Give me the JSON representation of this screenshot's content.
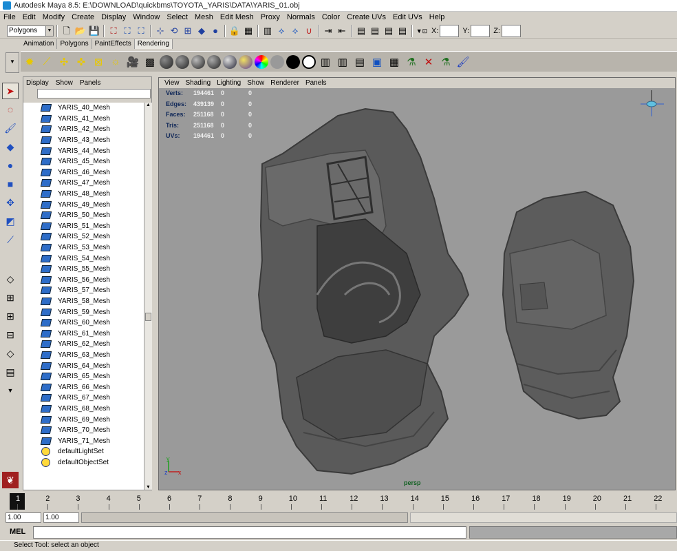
{
  "window": {
    "title": "Autodesk Maya 8.5: E:\\DOWNLOAD\\quickbms\\TOYOTA_YARIS\\DATA\\YARIS_01.obj"
  },
  "menubar": {
    "items": [
      "File",
      "Edit",
      "Modify",
      "Create",
      "Display",
      "Window",
      "Select",
      "Mesh",
      "Edit Mesh",
      "Proxy",
      "Normals",
      "Color",
      "Create UVs",
      "Edit UVs",
      "Help"
    ]
  },
  "statusline": {
    "mode": "Polygons",
    "x_label": "X:",
    "y_label": "Y:",
    "z_label": "Z:"
  },
  "shelf": {
    "tabs": [
      "Animation",
      "Polygons",
      "PaintEffects",
      "Rendering"
    ],
    "active_tab": "Rendering"
  },
  "outliner": {
    "menu": [
      "Display",
      "Show",
      "Panels"
    ],
    "items": [
      "YARIS_40_Mesh",
      "YARIS_41_Mesh",
      "YARIS_42_Mesh",
      "YARIS_43_Mesh",
      "YARIS_44_Mesh",
      "YARIS_45_Mesh",
      "YARIS_46_Mesh",
      "YARIS_47_Mesh",
      "YARIS_48_Mesh",
      "YARIS_49_Mesh",
      "YARIS_50_Mesh",
      "YARIS_51_Mesh",
      "YARIS_52_Mesh",
      "YARIS_53_Mesh",
      "YARIS_54_Mesh",
      "YARIS_55_Mesh",
      "YARIS_56_Mesh",
      "YARIS_57_Mesh",
      "YARIS_58_Mesh",
      "YARIS_59_Mesh",
      "YARIS_60_Mesh",
      "YARIS_61_Mesh",
      "YARIS_62_Mesh",
      "YARIS_63_Mesh",
      "YARIS_64_Mesh",
      "YARIS_65_Mesh",
      "YARIS_66_Mesh",
      "YARIS_67_Mesh",
      "YARIS_68_Mesh",
      "YARIS_69_Mesh",
      "YARIS_70_Mesh",
      "YARIS_71_Mesh"
    ],
    "sets": [
      "defaultLightSet",
      "defaultObjectSet"
    ]
  },
  "viewport": {
    "menu": [
      "View",
      "Shading",
      "Lighting",
      "Show",
      "Renderer",
      "Panels"
    ],
    "hud": [
      {
        "label": "Verts:",
        "v1": "194461",
        "v2": "0",
        "v3": "0"
      },
      {
        "label": "Edges:",
        "v1": "439139",
        "v2": "0",
        "v3": "0"
      },
      {
        "label": "Faces:",
        "v1": "251168",
        "v2": "0",
        "v3": "0"
      },
      {
        "label": "Tris:",
        "v1": "251168",
        "v2": "0",
        "v3": "0"
      },
      {
        "label": "UVs:",
        "v1": "194461",
        "v2": "0",
        "v3": "0"
      }
    ],
    "camera": "persp",
    "axis_labels": [
      "z",
      "x",
      "y"
    ]
  },
  "timeline": {
    "frames": [
      "1",
      "2",
      "3",
      "4",
      "5",
      "6",
      "7",
      "8",
      "9",
      "10",
      "11",
      "12",
      "13",
      "14",
      "15",
      "16",
      "17",
      "18",
      "19",
      "20",
      "21",
      "22"
    ],
    "current": "1"
  },
  "range": {
    "start": "1.00",
    "start2": "1.00"
  },
  "cmdline": {
    "label": "MEL"
  },
  "status": {
    "help": "Select Tool: select an object"
  },
  "colors": {
    "ui_bg": "#d4d0c8",
    "viewport_bg": "#9a9a9a",
    "mesh_icon": "#2e6dc8",
    "hud_label": "#102858"
  }
}
